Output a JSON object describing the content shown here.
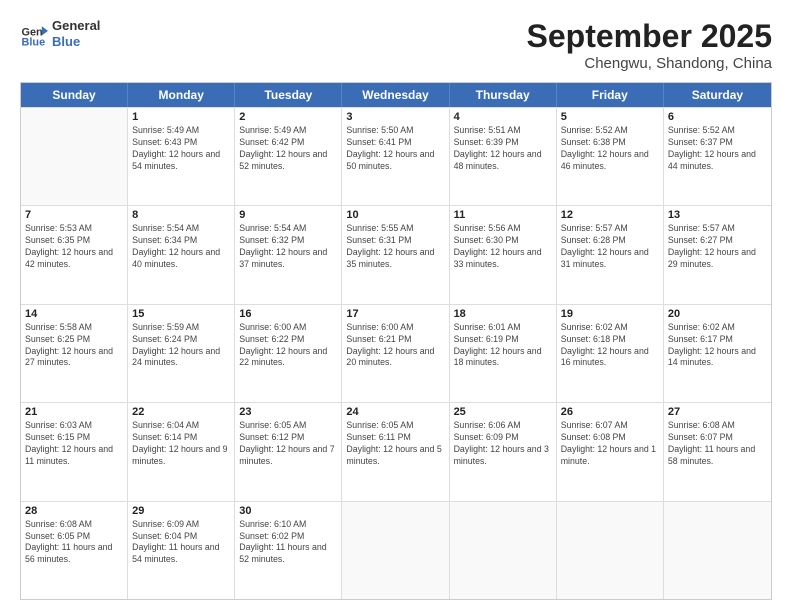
{
  "header": {
    "logo_general": "General",
    "logo_blue": "Blue",
    "month_year": "September 2025",
    "location": "Chengwu, Shandong, China"
  },
  "days_of_week": [
    "Sunday",
    "Monday",
    "Tuesday",
    "Wednesday",
    "Thursday",
    "Friday",
    "Saturday"
  ],
  "weeks": [
    [
      {
        "day": null
      },
      {
        "day": "1",
        "sunrise": "5:49 AM",
        "sunset": "6:43 PM",
        "daylight": "12 hours and 54 minutes."
      },
      {
        "day": "2",
        "sunrise": "5:49 AM",
        "sunset": "6:42 PM",
        "daylight": "12 hours and 52 minutes."
      },
      {
        "day": "3",
        "sunrise": "5:50 AM",
        "sunset": "6:41 PM",
        "daylight": "12 hours and 50 minutes."
      },
      {
        "day": "4",
        "sunrise": "5:51 AM",
        "sunset": "6:39 PM",
        "daylight": "12 hours and 48 minutes."
      },
      {
        "day": "5",
        "sunrise": "5:52 AM",
        "sunset": "6:38 PM",
        "daylight": "12 hours and 46 minutes."
      },
      {
        "day": "6",
        "sunrise": "5:52 AM",
        "sunset": "6:37 PM",
        "daylight": "12 hours and 44 minutes."
      }
    ],
    [
      {
        "day": "7",
        "sunrise": "5:53 AM",
        "sunset": "6:35 PM",
        "daylight": "12 hours and 42 minutes."
      },
      {
        "day": "8",
        "sunrise": "5:54 AM",
        "sunset": "6:34 PM",
        "daylight": "12 hours and 40 minutes."
      },
      {
        "day": "9",
        "sunrise": "5:54 AM",
        "sunset": "6:32 PM",
        "daylight": "12 hours and 37 minutes."
      },
      {
        "day": "10",
        "sunrise": "5:55 AM",
        "sunset": "6:31 PM",
        "daylight": "12 hours and 35 minutes."
      },
      {
        "day": "11",
        "sunrise": "5:56 AM",
        "sunset": "6:30 PM",
        "daylight": "12 hours and 33 minutes."
      },
      {
        "day": "12",
        "sunrise": "5:57 AM",
        "sunset": "6:28 PM",
        "daylight": "12 hours and 31 minutes."
      },
      {
        "day": "13",
        "sunrise": "5:57 AM",
        "sunset": "6:27 PM",
        "daylight": "12 hours and 29 minutes."
      }
    ],
    [
      {
        "day": "14",
        "sunrise": "5:58 AM",
        "sunset": "6:25 PM",
        "daylight": "12 hours and 27 minutes."
      },
      {
        "day": "15",
        "sunrise": "5:59 AM",
        "sunset": "6:24 PM",
        "daylight": "12 hours and 24 minutes."
      },
      {
        "day": "16",
        "sunrise": "6:00 AM",
        "sunset": "6:22 PM",
        "daylight": "12 hours and 22 minutes."
      },
      {
        "day": "17",
        "sunrise": "6:00 AM",
        "sunset": "6:21 PM",
        "daylight": "12 hours and 20 minutes."
      },
      {
        "day": "18",
        "sunrise": "6:01 AM",
        "sunset": "6:19 PM",
        "daylight": "12 hours and 18 minutes."
      },
      {
        "day": "19",
        "sunrise": "6:02 AM",
        "sunset": "6:18 PM",
        "daylight": "12 hours and 16 minutes."
      },
      {
        "day": "20",
        "sunrise": "6:02 AM",
        "sunset": "6:17 PM",
        "daylight": "12 hours and 14 minutes."
      }
    ],
    [
      {
        "day": "21",
        "sunrise": "6:03 AM",
        "sunset": "6:15 PM",
        "daylight": "12 hours and 11 minutes."
      },
      {
        "day": "22",
        "sunrise": "6:04 AM",
        "sunset": "6:14 PM",
        "daylight": "12 hours and 9 minutes."
      },
      {
        "day": "23",
        "sunrise": "6:05 AM",
        "sunset": "6:12 PM",
        "daylight": "12 hours and 7 minutes."
      },
      {
        "day": "24",
        "sunrise": "6:05 AM",
        "sunset": "6:11 PM",
        "daylight": "12 hours and 5 minutes."
      },
      {
        "day": "25",
        "sunrise": "6:06 AM",
        "sunset": "6:09 PM",
        "daylight": "12 hours and 3 minutes."
      },
      {
        "day": "26",
        "sunrise": "6:07 AM",
        "sunset": "6:08 PM",
        "daylight": "12 hours and 1 minute."
      },
      {
        "day": "27",
        "sunrise": "6:08 AM",
        "sunset": "6:07 PM",
        "daylight": "11 hours and 58 minutes."
      }
    ],
    [
      {
        "day": "28",
        "sunrise": "6:08 AM",
        "sunset": "6:05 PM",
        "daylight": "11 hours and 56 minutes."
      },
      {
        "day": "29",
        "sunrise": "6:09 AM",
        "sunset": "6:04 PM",
        "daylight": "11 hours and 54 minutes."
      },
      {
        "day": "30",
        "sunrise": "6:10 AM",
        "sunset": "6:02 PM",
        "daylight": "11 hours and 52 minutes."
      },
      {
        "day": null
      },
      {
        "day": null
      },
      {
        "day": null
      },
      {
        "day": null
      }
    ]
  ]
}
